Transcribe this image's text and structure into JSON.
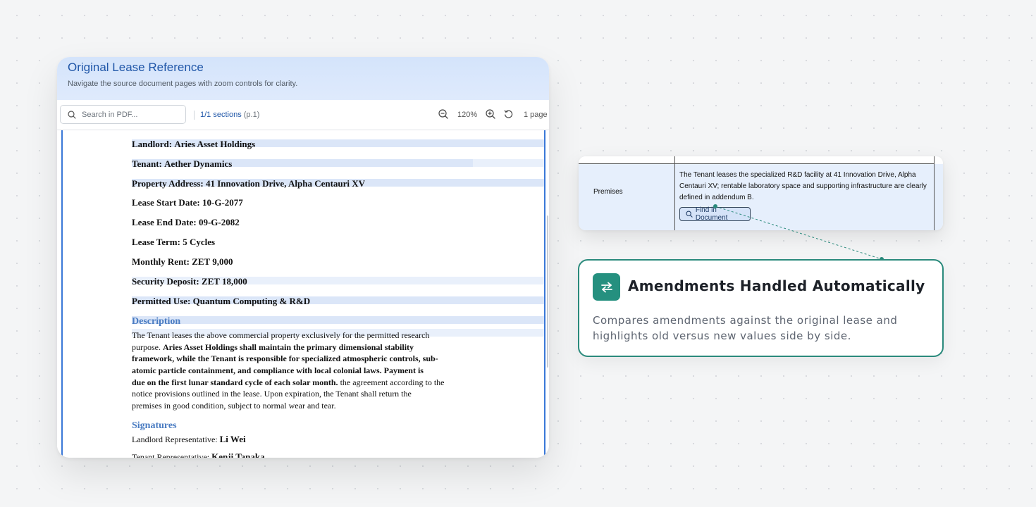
{
  "viewer": {
    "title": "Original Lease Reference",
    "subtitle": "Navigate the source document pages with zoom controls for clarity.",
    "search_placeholder": "Search in PDF...",
    "sections_label": "1/1 sections",
    "sections_page": "(p.1)",
    "zoom_level": "120%",
    "page_count": "1 page"
  },
  "document": {
    "fields": [
      {
        "label": "Landlord:",
        "value": "Aries Asset Holdings"
      },
      {
        "label": "Tenant:",
        "value": "Aether Dynamics"
      },
      {
        "label": "Property Address:",
        "value": "41 Innovation Drive, Alpha Centauri XV"
      },
      {
        "label": "Lease Start Date:",
        "value": "10-G-2077"
      },
      {
        "label": "Lease End Date:",
        "value": "09-G-2082"
      },
      {
        "label": "Lease Term:",
        "value": "5 Cycles"
      },
      {
        "label": "Monthly Rent:",
        "value": "ZET 9,000"
      },
      {
        "label": "Security Deposit:",
        "value": "ZET 18,000"
      },
      {
        "label": "Permitted Use:",
        "value": "Quantum Computing & R&D"
      }
    ],
    "description_heading": "Description",
    "description_lines": [
      [
        "The Tenant leases the above commercial property exclusively for the permitted research",
        ""
      ],
      [
        "purpose. ",
        "Aries Asset Holdings shall maintain the primary dimensional stability"
      ],
      [
        "",
        "framework, while the Tenant is responsible for specialized atmospheric controls, sub-"
      ],
      [
        "",
        "atomic particle containment, and compliance with local colonial laws. Payment is"
      ],
      [
        "",
        "due on the first lunar standard cycle of each solar month."
      ],
      [
        "notice provisions outlined in the lease. Upon expiration, the Tenant shall return the",
        ""
      ],
      [
        "premises in good condition, subject to normal wear and tear.",
        ""
      ]
    ],
    "description_line5_tail": " the agreement according to the",
    "signatures_heading": "Signatures",
    "landlord_rep_label": "Landlord Representative:",
    "landlord_rep_value": "Li Wei",
    "tenant_rep_label": "Tenant Representative:",
    "tenant_rep_value": "Kenji Tanaka"
  },
  "snippet": {
    "row_label": "Premises",
    "row_text": "The Tenant leases the specialized R&D facility at 41 Innovation Drive, Alpha Centauri XV; rentable laboratory space and supporting infrastructure are clearly defined in addendum B.",
    "find_button": "Find in Document"
  },
  "callout": {
    "title": "Amendments Handled Automatically",
    "description": "Compares amendments against the original lease and highlights old versus new values side by side.",
    "icon": "swap-arrows-icon",
    "accent_color": "#25907f"
  }
}
